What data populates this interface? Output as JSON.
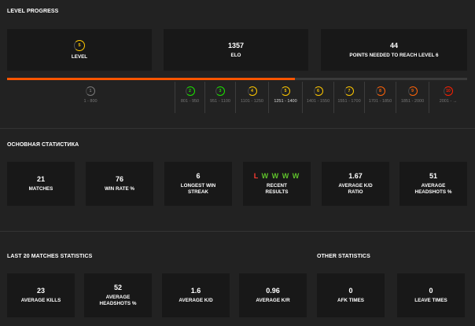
{
  "level_progress": {
    "title": "LEVEL PROGRESS",
    "cards": [
      {
        "icon": "5",
        "label": "LEVEL"
      },
      {
        "value": "1357",
        "label": "ELO"
      },
      {
        "value": "44",
        "label": "POINTS NEEDED TO REACH LEVEL 6"
      }
    ],
    "progress": 0.625,
    "levels": [
      {
        "num": "1",
        "range": "1 - 800",
        "color": "#7a7a7a"
      },
      {
        "num": "2",
        "range": "801 - 950",
        "color": "#1ce400"
      },
      {
        "num": "3",
        "range": "951 - 1100",
        "color": "#1ce400"
      },
      {
        "num": "4",
        "range": "1101 - 1250",
        "color": "#ffc800"
      },
      {
        "num": "5",
        "range": "1251 - 1400",
        "color": "#ffc800"
      },
      {
        "num": "6",
        "range": "1401 - 1550",
        "color": "#ffc800"
      },
      {
        "num": "7",
        "range": "1551 - 1700",
        "color": "#ffc800"
      },
      {
        "num": "8",
        "range": "1701 - 1850",
        "color": "#ff6309"
      },
      {
        "num": "9",
        "range": "1851 - 2000",
        "color": "#ff6309"
      },
      {
        "num": "10",
        "range": "2001 - →",
        "color": "#fe1f00"
      }
    ]
  },
  "main_stats": {
    "title": "ОСНОВНАЯ СТАТИСТИКА",
    "cards": [
      {
        "value": "21",
        "label": "MATCHES"
      },
      {
        "value": "76",
        "label": "WIN RATE %"
      },
      {
        "value": "6",
        "label": "LONGEST WIN STREAK"
      },
      {
        "label": "RECENT RESULTS"
      },
      {
        "value": "1.67",
        "label": "AVERAGE K/D RATIO"
      },
      {
        "value": "51",
        "label": "AVERAGE HEADSHOTS %"
      }
    ],
    "recent_results": [
      "L",
      "W",
      "W",
      "W",
      "W"
    ]
  },
  "last20": {
    "title": "LAST 20 MATCHES STATISTICS",
    "cards": [
      {
        "value": "23",
        "label": "AVERAGE KILLS"
      },
      {
        "value": "52",
        "label": "AVERAGE HEADSHOTS %"
      },
      {
        "value": "1.6",
        "label": "AVERAGE K/D"
      },
      {
        "value": "0.96",
        "label": "AVERAGE K/R"
      }
    ]
  },
  "other": {
    "title": "OTHER STATISTICS",
    "cards": [
      {
        "value": "0",
        "label": "AFK TIMES"
      },
      {
        "value": "0",
        "label": "LEAVE TIMES"
      }
    ]
  },
  "colors": {
    "accent": "#ff5500",
    "win": "#5ec12b",
    "loss": "#ff3b30",
    "background": "#222222",
    "card": "#181818"
  }
}
